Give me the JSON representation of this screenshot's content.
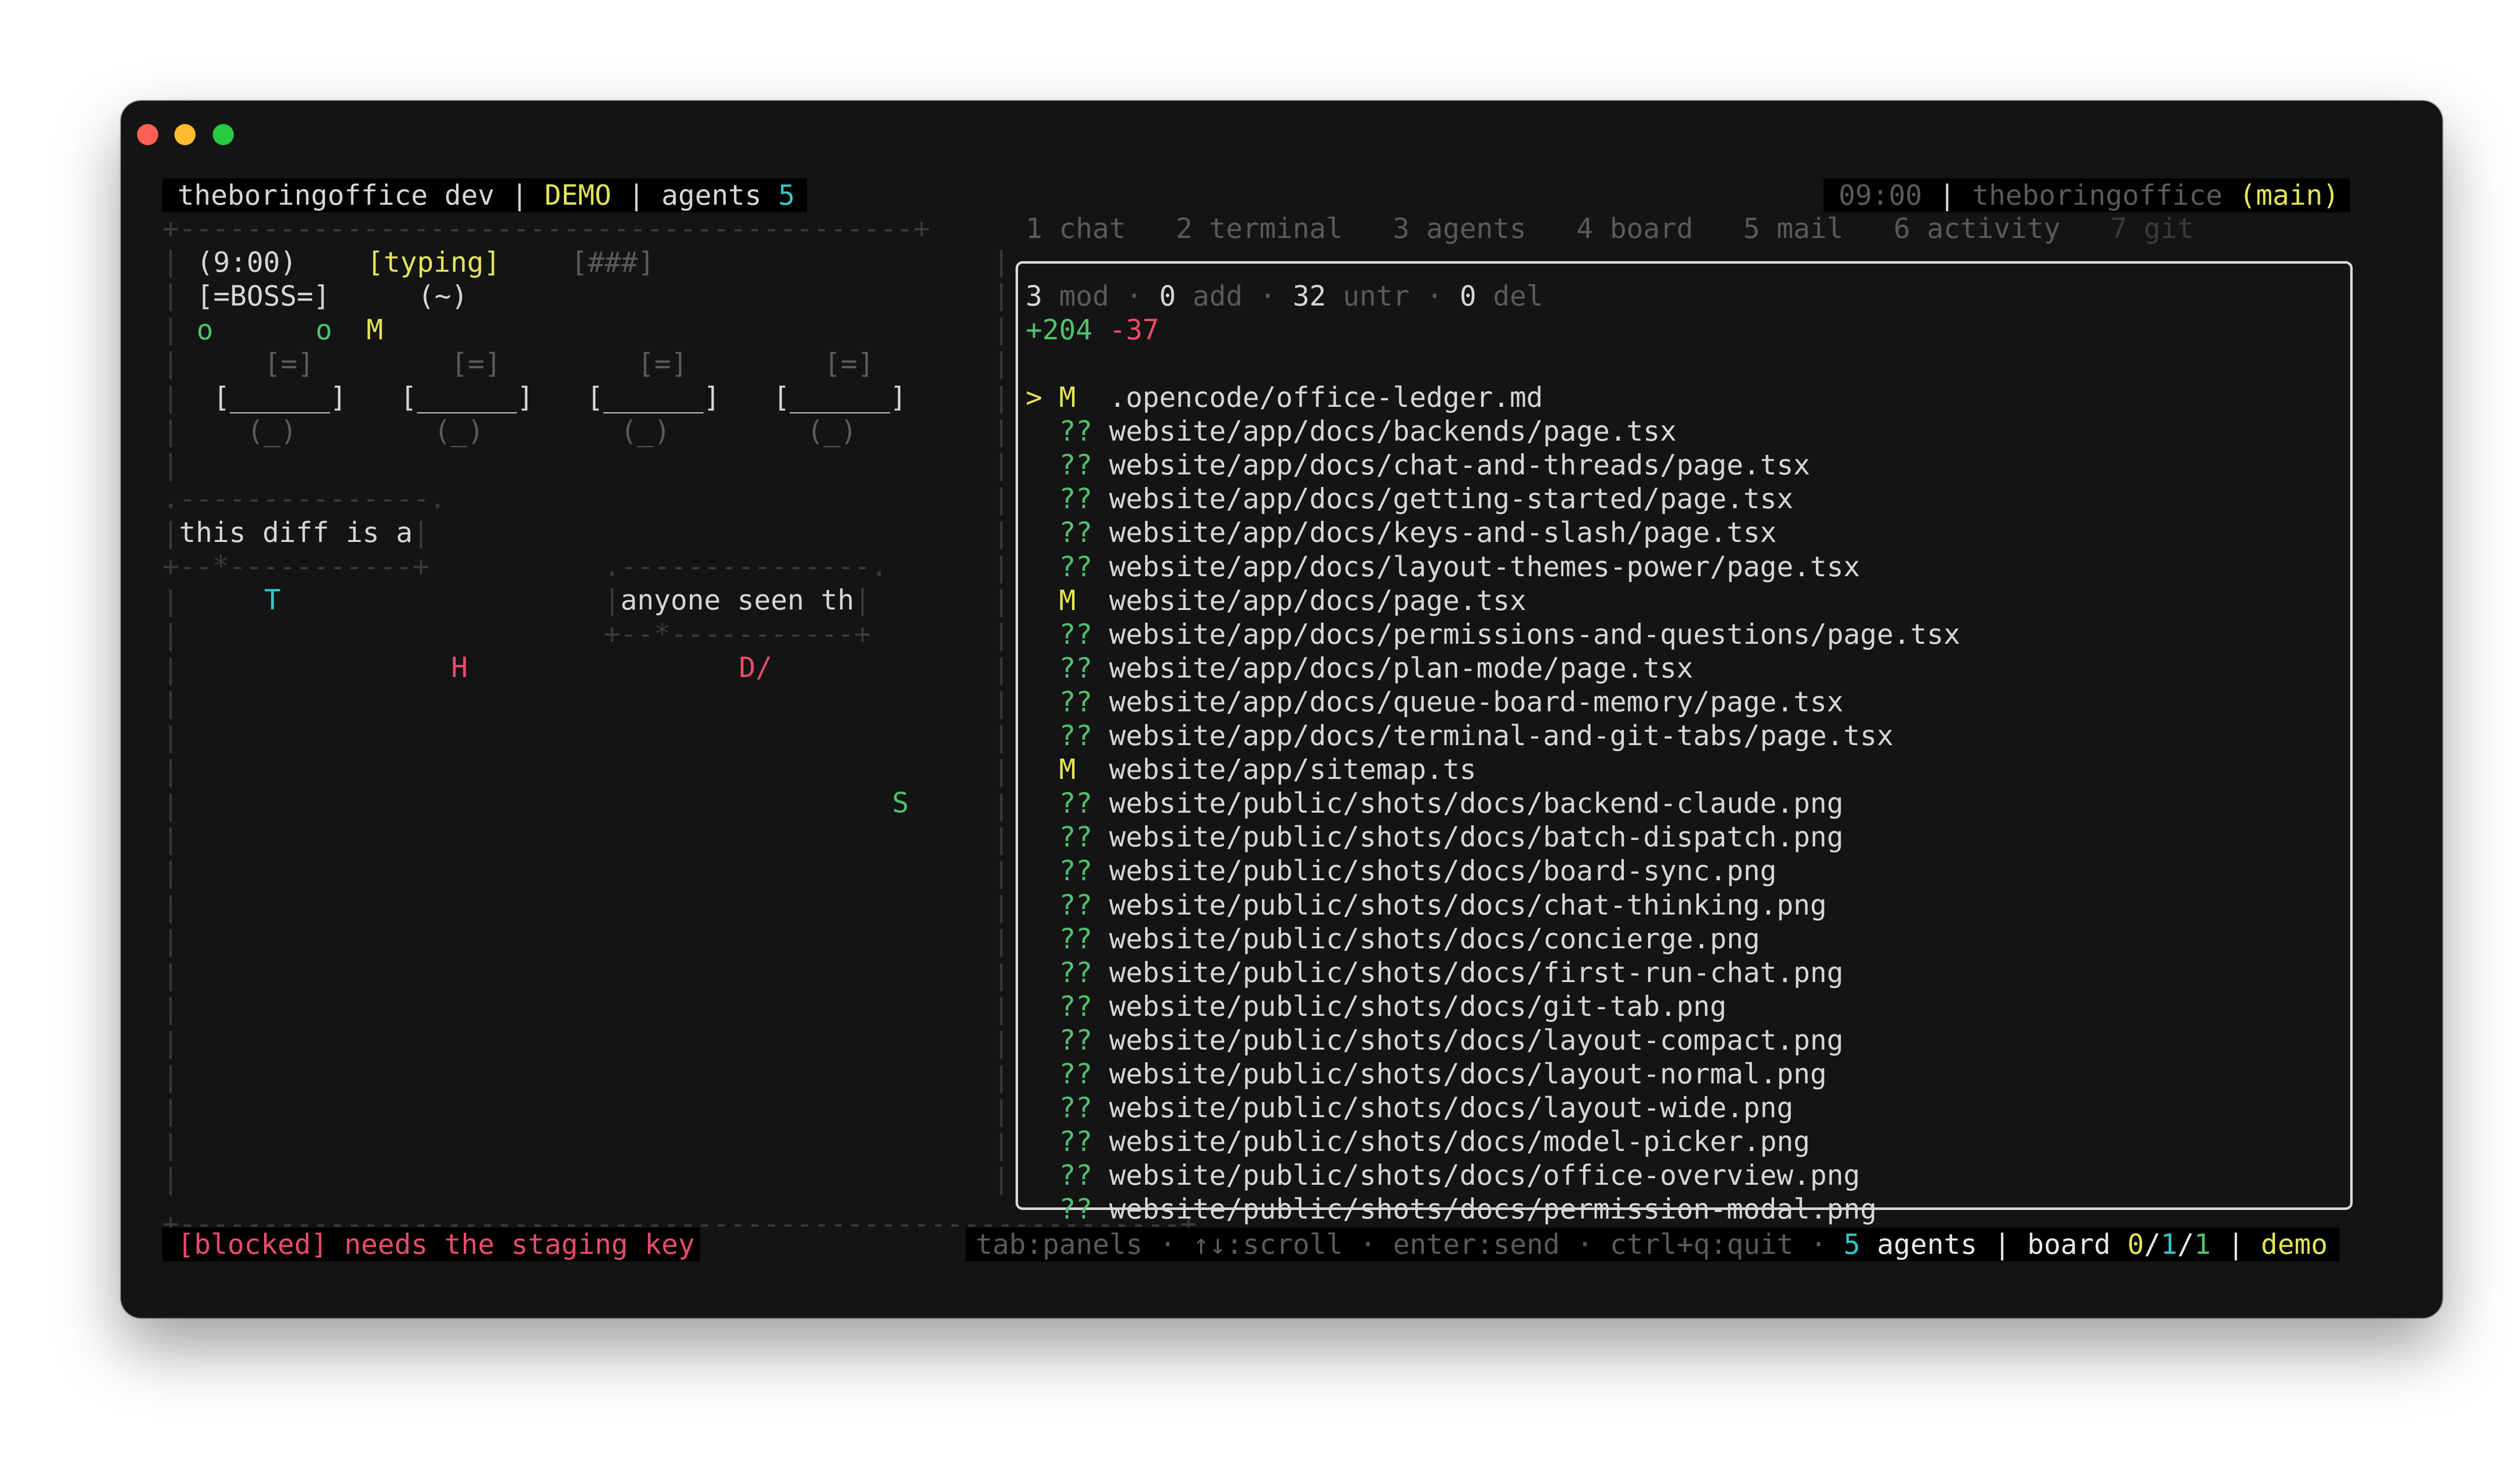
{
  "header": {
    "app": "theboringoffice dev",
    "mode": "DEMO",
    "agents_label": "agents",
    "agents_count": "5",
    "sep": "|",
    "time": "09:00",
    "repo": "theboringoffice",
    "branch": "(main)"
  },
  "tabs": [
    {
      "label": "1 chat"
    },
    {
      "label": "2 terminal"
    },
    {
      "label": "3 agents"
    },
    {
      "label": "4 board"
    },
    {
      "label": "5 mail"
    },
    {
      "label": "6 activity"
    },
    {
      "label": "7 git",
      "active": true
    }
  ],
  "office": {
    "border_top": "+--------------------------------------------+",
    "boss_time": "(9:00)",
    "boss_status": "[typing]",
    "boss_progress": "[###]",
    "boss_name": "[=BOSS=]",
    "boss_face": "(~)",
    "agent_o1": "o",
    "agent_o2": "o",
    "agent_m": "M",
    "monitor": "[=]",
    "desk": "[______]",
    "chair": "(_)",
    "bubble1_top": ".---------------.",
    "bubble1_text": "this diff is a",
    "bubble1_bottom": "+--*-----------+",
    "bubble2_top": ".---------------.",
    "bubble2_text": "anyone seen th",
    "bubble2_bottom": "+--*-----------+",
    "agent_t": "T",
    "agent_h": "H",
    "agent_d": "D/",
    "agent_s": "S",
    "border_bottom": "+------------------------------------------------------------+"
  },
  "git": {
    "stats": {
      "mod_count": "3",
      "mod_label": "mod",
      "add_count": "0",
      "add_label": "add",
      "untr_count": "32",
      "untr_label": "untr",
      "del_count": "0",
      "del_label": "del",
      "dot": "·"
    },
    "lines_added": "+204",
    "lines_removed": "-37",
    "cursor": ">",
    "files": [
      {
        "status": "M",
        "path": ".opencode/office-ledger.md",
        "selected": true
      },
      {
        "status": "??",
        "path": "website/app/docs/backends/page.tsx"
      },
      {
        "status": "??",
        "path": "website/app/docs/chat-and-threads/page.tsx"
      },
      {
        "status": "??",
        "path": "website/app/docs/getting-started/page.tsx"
      },
      {
        "status": "??",
        "path": "website/app/docs/keys-and-slash/page.tsx"
      },
      {
        "status": "??",
        "path": "website/app/docs/layout-themes-power/page.tsx"
      },
      {
        "status": "M",
        "path": "website/app/docs/page.tsx"
      },
      {
        "status": "??",
        "path": "website/app/docs/permissions-and-questions/page.tsx"
      },
      {
        "status": "??",
        "path": "website/app/docs/plan-mode/page.tsx"
      },
      {
        "status": "??",
        "path": "website/app/docs/queue-board-memory/page.tsx"
      },
      {
        "status": "??",
        "path": "website/app/docs/terminal-and-git-tabs/page.tsx"
      },
      {
        "status": "M",
        "path": "website/app/sitemap.ts"
      },
      {
        "status": "??",
        "path": "website/public/shots/docs/backend-claude.png"
      },
      {
        "status": "??",
        "path": "website/public/shots/docs/batch-dispatch.png"
      },
      {
        "status": "??",
        "path": "website/public/shots/docs/board-sync.png"
      },
      {
        "status": "??",
        "path": "website/public/shots/docs/chat-thinking.png"
      },
      {
        "status": "??",
        "path": "website/public/shots/docs/concierge.png"
      },
      {
        "status": "??",
        "path": "website/public/shots/docs/first-run-chat.png"
      },
      {
        "status": "??",
        "path": "website/public/shots/docs/git-tab.png"
      },
      {
        "status": "??",
        "path": "website/public/shots/docs/layout-compact.png"
      },
      {
        "status": "??",
        "path": "website/public/shots/docs/layout-normal.png"
      },
      {
        "status": "??",
        "path": "website/public/shots/docs/layout-wide.png"
      },
      {
        "status": "??",
        "path": "website/public/shots/docs/model-picker.png"
      },
      {
        "status": "??",
        "path": "website/public/shots/docs/office-overview.png"
      },
      {
        "status": "??",
        "path": "website/public/shots/docs/permission-modal.png"
      }
    ]
  },
  "footer": {
    "blocked": "[blocked] needs the staging key",
    "hints": "tab:panels · ↑↓:scroll · enter:send · ctrl+q:quit ·",
    "agents_count": "5",
    "agents_label": "agents",
    "sep": "|",
    "board_label": "board",
    "board_a": "0",
    "board_slash": "/",
    "board_b": "1",
    "board_c": "1",
    "demo": "demo"
  },
  "colors": {
    "background": "#141414",
    "yellow": "#e3e35a",
    "cyan": "#38c6c6",
    "green": "#4ec26e",
    "red": "#e64d6b"
  }
}
